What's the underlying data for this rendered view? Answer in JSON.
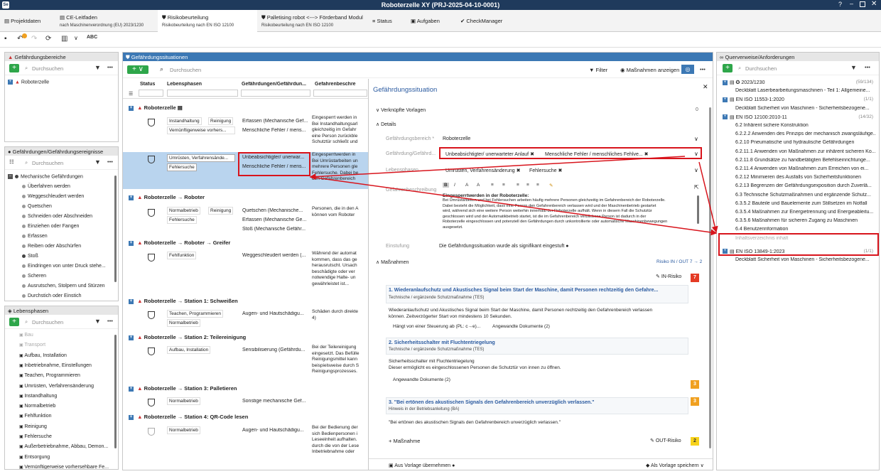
{
  "title": "Roboterzelle XY (PRJ-2025-04-10-0001)",
  "tabs": [
    {
      "label": "Projektdaten",
      "sub": ""
    },
    {
      "label": "CE-Leitfaden",
      "sub": "nach Maschinenverordnung (EU) 2023/1230"
    },
    {
      "label": "Risikobeurteilung",
      "sub": "Risikobeurteilung nach EN ISO 12100"
    },
    {
      "label": "Palletising robot <---> Förderband Modul",
      "sub": "Risikobeurteilung nach EN ISO 12100"
    },
    {
      "label": "Status",
      "sub": ""
    },
    {
      "label": "Aufgaben",
      "sub": ""
    },
    {
      "label": "CheckManager",
      "sub": ""
    }
  ],
  "left": {
    "bereiche_title": "Gefährdungsbereiche",
    "search_placeholder": "Durchsuchen",
    "bereiche_items": [
      "Roboterzelle"
    ],
    "ereignisse_title": "Gefährdungen/Gefährdungsereignisse",
    "ereignisse_root": "Mechanische Gefährdungen",
    "ereignisse_items": [
      "Überfahren werden",
      "Weggeschleudert werden",
      "Quetschen",
      "Schneiden oder Abschneiden",
      "Einziehen oder Fangen",
      "Erfassen",
      "Reiben oder Abschürfen",
      "Stoß",
      "Eindringen von unter Druck stehe...",
      "Scheren",
      "Ausrutschen, Stolpern und Stürzen",
      "Durchstich oder Einstich"
    ],
    "phasen_title": "Lebensphasen",
    "phasen_items": [
      "Bau",
      "Transport",
      "Aufbau, Installation",
      "Inbetriebnahme, Einstellungen",
      "Teachen, Programmieren",
      "Umrüsten, Verfahrensänderung",
      "Instandhaltung",
      "Normalbetrieb",
      "Fehlfunktion",
      "Reinigung",
      "Fehlersuche",
      "Außerbetriebnahme, Abbau, Demon...",
      "Entsorgung",
      "Vernünftigerweise vorhersehbare Fe..."
    ]
  },
  "mid": {
    "title": "Gefährdungssituationen",
    "search_placeholder": "Durchsuchen",
    "filter": "Filter",
    "show_measures": "Maßnahmen anzeigen",
    "columns": [
      "Status",
      "Lebensphasen",
      "Gefährdungen/Gefährdun...",
      "Gefahrenbeschre"
    ],
    "groups": [
      {
        "label": "Roboterzelle"
      },
      {
        "label": "Roboterzelle → Roboter"
      },
      {
        "label": "Roboterzelle → Roboter → Greifer"
      },
      {
        "label": "Roboterzelle → Station 1: Schweißen"
      },
      {
        "label": "Roboterzelle → Station 2: Teilereinigung"
      },
      {
        "label": "Roboterzelle → Station 3: Palletieren"
      },
      {
        "label": "Roboterzelle → Station 4: QR-Code lesen"
      }
    ],
    "r1": {
      "p1": "Instandhaltung",
      "p2": "Reinigung",
      "p3": "Vernünftigerweise vorhers...",
      "g1": "Erfassen (Mechanische Gef...",
      "g2": "Menschliche Fehler / mens...",
      "d": [
        "Eingesperrt werden in",
        "Bei Instandhaltungsarl",
        "gleichzeitig im Gefahr",
        "eine Person zurückble",
        "Schutztür schließt und"
      ]
    },
    "r2": {
      "p1": "Umrüsten, Verfahrensände...",
      "p2": "Fehlersuche",
      "g1": "Unbeabsichtigter/ unerwar...",
      "g2": "Menschliche Fehler / mens...",
      "d": [
        "Eingesperrtwerden in",
        "Bei Umrüstarbeiten un",
        "mehrere Personen gle",
        "Fehlersuche. Dabei be",
        "den Gefahrenbereich"
      ]
    },
    "r3": {
      "p1": "Normalbetrieb",
      "p2": "Reinigung",
      "p3": "Fehlersuche",
      "g1": "Quetschen (Mechanische...",
      "g2": "Erfassen (Mechanische Ge...",
      "g3": "Stoß (Mechanische Gefähr...",
      "d": [
        "Personen, die in den A",
        "können vom Roboter"
      ]
    },
    "r4": {
      "p1": "Fehlfunktion",
      "g1": "Weggeschleudert werden (...",
      "d": [
        "Während der automat",
        "kommen, dass das ge",
        "herausrutscht. Ursach",
        "beschädigte oder ver",
        "notwendige Halte- un",
        "gewährleistet ist..."
      ]
    },
    "r5": {
      "p1": "Teachen, Programmieren",
      "p2": "Normalbetrieb",
      "g1": "Augen- und Hautschädigu...",
      "d": [
        "Schäden durch direkte",
        "4)"
      ]
    },
    "r6": {
      "p1": "Aufbau, Installation",
      "g1": "Sensibilisierung (Gefährdu...",
      "d": [
        "Bei der Teilereinigung",
        "eingesetzt. Das Befülle",
        "Reinigungsmittel kann",
        "beispielsweise durch S",
        "Reinigungsprozesses."
      ]
    },
    "r7": {
      "p1": "Normalbetrieb",
      "g1": "Sonstige mechanische Gef..."
    },
    "r8": {
      "p1": "Normalbetrieb",
      "g1": "Augen- und Hautschädigu...",
      "d": [
        "Bei der Bedienung der",
        "sich Bedienpersonen i",
        "Leseeinheit aufhalten.",
        "durch die von der Lese",
        "Inbetriebnahme oder"
      ]
    }
  },
  "detail": {
    "title": "Gefährdungssituation",
    "linked": "Verknüpfte Vorlagen",
    "linked_count": "0",
    "details": "Details",
    "lbl_bereich": "Gefährdungsbereich *",
    "val_bereich": "Roboterzelle",
    "lbl_gef": "Gefährdung/Gefährd...",
    "gef1": "Unbeabsichtigter/ unerwarteter Anlauf",
    "gef2": "Menschliche Fehler / menschliches Fehlve...",
    "lbl_phasen": "Lebensphasen",
    "ph1": "Umrüsten, Verfahrensänderung",
    "ph2": "Fehlersuche",
    "lbl_desc": "Gefahrenbeschreibung",
    "desc_title": "Eingesperrtwerden in der Roboterzelle:",
    "desc": [
      "Bei Umrüstarbeiten und bei Fehlersuchen arbeiten häufig mehrere Personen gleichzeitig im Gefahrenbereich der Roboterzelle.",
      "Dabei besteht die Möglichkeit, dass eine Person den Gefahrenbereich verlassen wird und der Maschinenbetrieb gestartet",
      "wird, während sich eine weitere Person weiterhin innerhalb der Roboterzelle aufhält. Wenn in diesem Fall die Schutztür",
      "geschlossen wird und der Automatikbetrieb startet, ist die im Gefahrenbereich verbliebene Person ist dadurch in der",
      "Roboterzelle eingeschlossen und potenziell den Gefährdungen durch unkontrollierte oder automatische Maschinenbewegungen",
      "ausgesetzt."
    ],
    "lbl_einst": "Einstufung",
    "einst": "Die Gefährdungssituation wurde als signifikant eingestuft",
    "massnahmen": "Maßnahmen",
    "risk_io": "Risiko IN / OUT 7",
    "risk_io2": "2",
    "in_risk": "IN-Risiko",
    "in_val": "7",
    "m1_title": "1. Wiederanlaufschutz und Akustisches Signal beim Start der Maschine, damit Personen rechtzeitig den Gefahre...",
    "m1_sub": "Technische / ergänzende Schutzmaßnahme (TES)",
    "m1_text1": "Wiederanlaufschutz und Akustisches Signal beim Start der Maschine, damit Personen rechtzeitig den Gefahrenbereich verlassen",
    "m1_text2": "können. Zeitverzögerter Start von mindestens 10 Sekunden.",
    "m1_dep": "Hängt von einer Steuerung ab (PL: c→e)...",
    "m1_docs": "Angewandte Dokumente (2)",
    "m2_title": "2. Sicherheitsschalter mit Fluchtentriegelung",
    "m2_sub": "Technische / ergänzende Schutzmaßnahme (TES)",
    "m2_text1": "Sicherheitsschalter mit Fluchtentriegelung",
    "m2_text2": "Dieser ermöglicht es eingeschlossenen Personen die Schutztür von innen zu öffnen.",
    "m2_docs": "Angewandte Dokumente (2)",
    "m2_val": "3",
    "m3_title": "3. \"Bei ertönen des akustischen Signals den Gefahrenbereich unverzüglich verlassen.\"",
    "m3_sub": "Hinweis in der Betriebsanleitung (BA)",
    "m3_text": "\"Bei ertönen des akustischen Signals den Gefahrenbereich unverzüglich verlassen.\"",
    "m3_val": "3",
    "add_m": "Maßnahme",
    "out_risk": "OUT-Risiko",
    "out_val": "2",
    "from_tpl": "Aus Vorlage übernehmen",
    "as_tpl": "Als Vorlage speichern"
  },
  "right": {
    "title": "Querverweise/Anforderungen",
    "search_placeholder": "Durchsuchen",
    "items": [
      {
        "t": "2023/1230",
        "c": "(59/134)"
      },
      {
        "t": "Deckblatt Laserbearbeitungsmaschinen - Teil 1: Allgemeine...",
        "c": ""
      },
      {
        "t": "EN ISO 11553-1:2020",
        "c": "(1/1)"
      },
      {
        "t": "Deckblatt Sicherheit von Maschinen - Sicherheitsbezogene...",
        "c": ""
      },
      {
        "t": "EN ISO 12100:2010-11",
        "c": "(14/32)"
      },
      {
        "t": "6.2 Inhärent sichere Konstruktion",
        "c": ""
      },
      {
        "t": "6.2.2.2 Anwenden des Prinzips der mechanisch zwangsläufige...",
        "c": ""
      },
      {
        "t": "6.2.10 Pneumatische und hydraulische Gefährdungen",
        "c": ""
      },
      {
        "t": "6.2.11.1 Anwenden von Maßnahmen zur inhärent sicheren Ko...",
        "c": ""
      },
      {
        "t": "6.2.11.8 Grundsätze zu handbetätigten Befehlseinrichtunge...",
        "c": ""
      },
      {
        "t": "6.2.11.4 Anwenden von Maßnahmen zum Erreichen von ei...",
        "c": ""
      },
      {
        "t": "6.2.12 Minimieren des Ausfalls von Sicherheitsfunktionen",
        "c": ""
      },
      {
        "t": "6.2.13 Begrenzen der Gefährdungsexposition durch Zuverlä...",
        "c": ""
      },
      {
        "t": "6.3 Technische Schutzmaßnahmen und ergänzende Schutz...",
        "c": ""
      },
      {
        "t": "6.3.5.2 Bauteile und Bauelemente zum Stillsetzen im Notfall",
        "c": ""
      },
      {
        "t": "6.3.5.4 Maßnahmen zur Energietrennung und Energieableitu...",
        "c": ""
      },
      {
        "t": "6.3.5.6 Maßnahmen für sicheren Zugang zu Maschinen",
        "c": ""
      },
      {
        "t": "6.4 Benutzerinformation",
        "c": ""
      },
      {
        "t": "Inhaltsverzeichnis inhalt",
        "c": ""
      },
      {
        "t": "EN ISO 13849-1:2023",
        "c": "(1/1)"
      },
      {
        "t": "Deckblatt Sicherheit von Maschinen - Sicherheitsbezogene...",
        "c": ""
      }
    ]
  }
}
